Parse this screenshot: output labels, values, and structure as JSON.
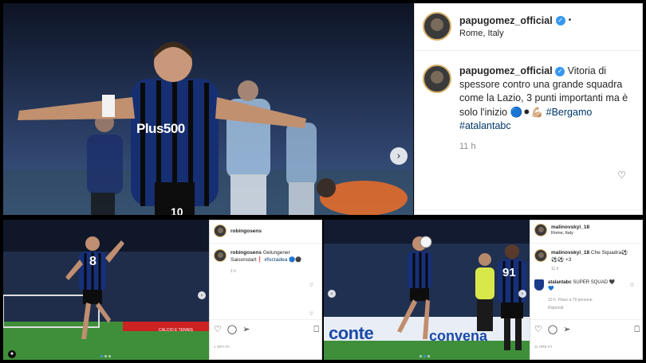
{
  "main_post": {
    "header": {
      "username": "papugomez_official",
      "location": "Rome, Italy"
    },
    "caption": {
      "username": "papugomez_official",
      "text": "Vitoria di spessore contro una grande squadra come la Lazio, 3 punti importanti ma è solo l'inizio",
      "emojis": "🔵⚫💪🏼",
      "hashtag1": "#Bergamo",
      "hashtag2": "#atalantabc"
    },
    "time": "11 h",
    "jersey_sponsor": "Plus500",
    "shirt_number": "10"
  },
  "post_left": {
    "username": "robingosens",
    "caption": "Gelungener Saisonstart❗️",
    "hashtag": "#forzadea",
    "emojis": "🔵⚫",
    "time_small": "1 h",
    "posted_ago": "1 ORA FA",
    "shirt_number": "8",
    "ad_board": "CALCIO E TENNIS"
  },
  "post_right": {
    "header": {
      "username": "malinovskyi_18",
      "location": "Rome, Italy"
    },
    "caption": {
      "username": "malinovskyi_18",
      "text": "Che Squadra⚽",
      "emojis": "⚽⚽ +3"
    },
    "time_small": "11 h",
    "comment": {
      "username": "atalantabc",
      "text": "SUPER SQUAD 🖤",
      "emoji": "💙",
      "time": "10 h",
      "likes": "Piace a 79 persone",
      "reply": "Rispondi"
    },
    "posted_ago": "11 ORE FA",
    "shirt_number": "91",
    "ad_board": "conte",
    "ad_board2": "convena"
  },
  "icons": {
    "next": "chevron-right-icon",
    "prev": "chevron-left-icon",
    "like": "heart-icon",
    "comment": "comment-icon",
    "share": "paper-plane-icon",
    "save": "bookmark-icon"
  },
  "colors": {
    "atalanta_blue": "#1a3a8a",
    "atalanta_black": "#111111",
    "lazio_sky": "#9cc3e6",
    "pitch_green": "#3f8f3a",
    "verified": "#3897f0",
    "hashtag": "#00376b"
  }
}
